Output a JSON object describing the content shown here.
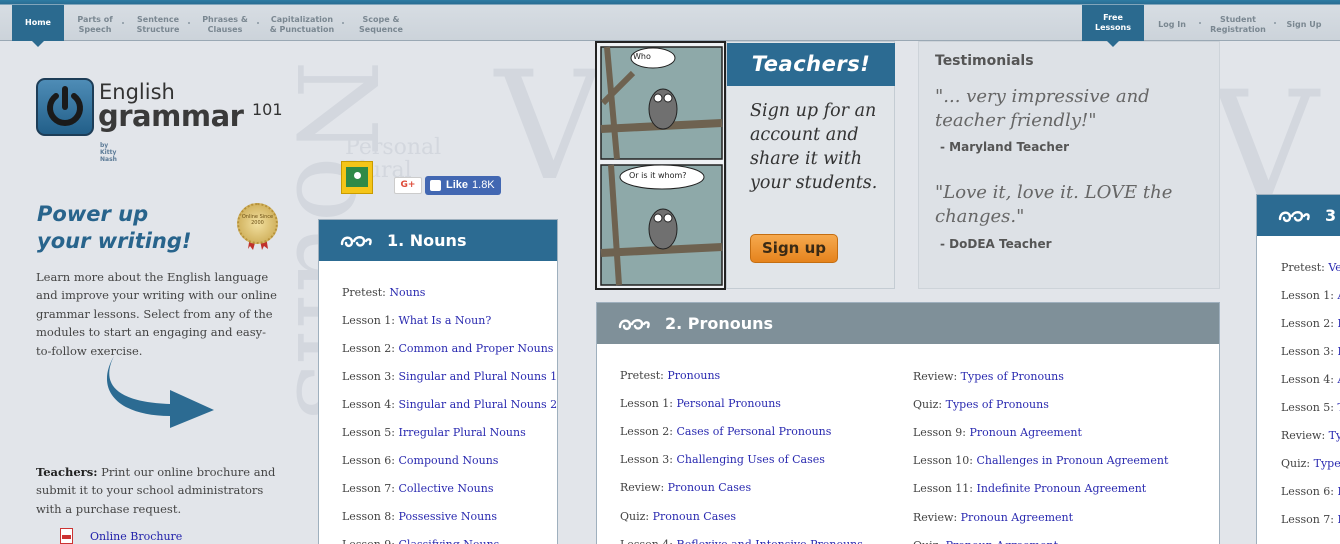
{
  "nav": {
    "left": [
      {
        "label": "Home",
        "active": true
      },
      {
        "label": "Parts of Speech"
      },
      {
        "label": "Sentence Structure"
      },
      {
        "label": "Phrases & Clauses"
      },
      {
        "label": "Capitalization & Punctuation"
      },
      {
        "label": "Scope & Sequence"
      }
    ],
    "right": [
      {
        "label": "Free Lessons",
        "active": true
      },
      {
        "label": "Log In"
      },
      {
        "label": "Student Registration"
      },
      {
        "label": "Sign Up"
      }
    ]
  },
  "logo": {
    "line1": "English",
    "line2": "grammar",
    "sup": "101",
    "by": "by Kitty Nash"
  },
  "seal": {
    "text": "Online Since 2000"
  },
  "sidebar": {
    "headline1": "Power up",
    "headline2": "your writing!",
    "intro": "Learn more about the English language and improve your writing with our online grammar lessons. Select from any of the modules to start an engaging and easy-to-follow exercise.",
    "teachers_label": "Teachers:",
    "teachers_text": " Print our online brochure and submit it to your school administrators with a purchase request.",
    "brochure_link": "Online Brochure"
  },
  "social": {
    "gplus": "G+",
    "like": "Like",
    "like_count": "1.8K"
  },
  "nouns": {
    "title": "1. Nouns",
    "lessons": [
      {
        "prefix": "Pretest:",
        "link": "Nouns"
      },
      {
        "prefix": "Lesson 1:",
        "link": "What Is a Noun?"
      },
      {
        "prefix": "Lesson 2:",
        "link": "Common and Proper Nouns"
      },
      {
        "prefix": "Lesson 3:",
        "link": "Singular and Plural Nouns 1"
      },
      {
        "prefix": "Lesson 4:",
        "link": "Singular and Plural Nouns 2"
      },
      {
        "prefix": "Lesson 5:",
        "link": "Irregular Plural Nouns"
      },
      {
        "prefix": "Lesson 6:",
        "link": "Compound Nouns"
      },
      {
        "prefix": "Lesson 7:",
        "link": "Collective Nouns"
      },
      {
        "prefix": "Lesson 8:",
        "link": "Possessive Nouns"
      },
      {
        "prefix": "Lesson 9:",
        "link": "Classifying Nouns"
      }
    ]
  },
  "pronouns": {
    "title": "2. Pronouns",
    "col1": [
      {
        "prefix": "Pretest:",
        "link": "Pronouns"
      },
      {
        "prefix": "Lesson 1:",
        "link": "Personal Pronouns"
      },
      {
        "prefix": "Lesson 2:",
        "link": "Cases of Personal Pronouns"
      },
      {
        "prefix": "Lesson 3:",
        "link": "Challenging Uses of Cases"
      },
      {
        "prefix": "Review:",
        "link": "Pronoun Cases"
      },
      {
        "prefix": "Quiz:",
        "link": "Pronoun Cases"
      },
      {
        "prefix": "Lesson 4:",
        "link": "Reflexive and Intensive Pronouns"
      }
    ],
    "col2": [
      {
        "prefix": "Review:",
        "link": "Types of Pronouns"
      },
      {
        "prefix": "Quiz:",
        "link": "Types of Pronouns"
      },
      {
        "prefix": "Lesson 9:",
        "link": "Pronoun Agreement"
      },
      {
        "prefix": "Lesson 10:",
        "link": "Challenges in Pronoun Agreement"
      },
      {
        "prefix": "Lesson 11:",
        "link": "Indefinite Pronoun Agreement"
      },
      {
        "prefix": "Review:",
        "link": "Pronoun Agreement"
      },
      {
        "prefix": "Quiz:",
        "link": "Pronoun Agreement"
      }
    ]
  },
  "third": {
    "title": "3",
    "lessons": [
      {
        "prefix": "Pretest:",
        "link": "Verbs"
      },
      {
        "prefix": "Lesson 1:",
        "link": "Action Verbs"
      },
      {
        "prefix": "Lesson 2:",
        "link": "Helping Verbs"
      },
      {
        "prefix": "Lesson 3:",
        "link": "Linking Verbs"
      },
      {
        "prefix": "Lesson 4:",
        "link": "Active Voice"
      },
      {
        "prefix": "Lesson 5:",
        "link": "The Verb Be"
      },
      {
        "prefix": "Review:",
        "link": "Types of Verbs"
      },
      {
        "prefix": "Quiz:",
        "link": "Types of Verbs"
      },
      {
        "prefix": "Lesson 6:",
        "link": "Principal Parts"
      },
      {
        "prefix": "Lesson 7:",
        "link": "Irregular Verbs"
      }
    ]
  },
  "comic": {
    "bubble1": "Who",
    "bubble2": "Or is it whom?"
  },
  "teachers": {
    "title": "Teachers!",
    "text": "Sign up for an account and share it with your students.",
    "button": "Sign up"
  },
  "testimonials": {
    "title": "Testimonials",
    "q1": "\"... very impressive and teacher friendly!\"",
    "a1": "- Maryland Teacher",
    "q2": "\"Love it, love it. LOVE the changes.\"",
    "a2": "- DoDEA Teacher"
  }
}
